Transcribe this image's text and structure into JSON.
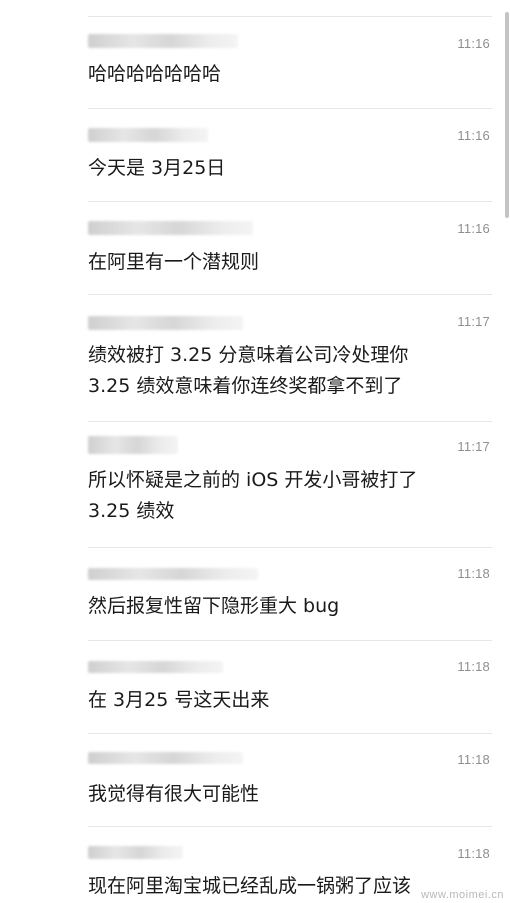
{
  "messages": [
    {
      "time": "11:16",
      "text": "哈哈哈哈哈哈哈"
    },
    {
      "time": "11:16",
      "text": "今天是 3月25日"
    },
    {
      "time": "11:16",
      "text": "在阿里有一个潜规则"
    },
    {
      "time": "11:17",
      "text": "绩效被打 3.25 分意味着公司冷处理你\n3.25 绩效意味着你连终奖都拿不到了"
    },
    {
      "time": "11:17",
      "text": "所以怀疑是之前的 iOS 开发小哥被打了\n3.25 绩效"
    },
    {
      "time": "11:18",
      "text": "然后报复性留下隐形重大 bug"
    },
    {
      "time": "11:18",
      "text": "在 3月25 号这天出来"
    },
    {
      "time": "11:18",
      "text": "我觉得有很大可能性"
    },
    {
      "time": "11:18",
      "text": "现在阿里淘宝城已经乱成一锅粥了应该"
    }
  ],
  "watermark": "www.moimei.cn"
}
